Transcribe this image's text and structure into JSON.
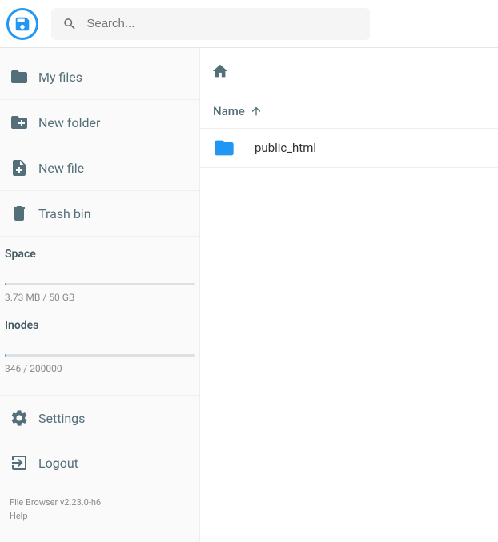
{
  "header": {
    "search_placeholder": "Search..."
  },
  "sidebar": {
    "items": [
      {
        "label": "My files"
      },
      {
        "label": "New folder"
      },
      {
        "label": "New file"
      },
      {
        "label": "Trash bin"
      }
    ],
    "space": {
      "title": "Space",
      "text": "3.73 MB / 50 GB",
      "percent": 0.01
    },
    "inodes": {
      "title": "Inodes",
      "text": "346 / 200000",
      "percent": 0.2
    },
    "settings_label": "Settings",
    "logout_label": "Logout",
    "version": "File Browser v2.23.0-h6",
    "help": "Help"
  },
  "main": {
    "list_header": "Name",
    "rows": [
      {
        "name": "public_html"
      }
    ]
  }
}
